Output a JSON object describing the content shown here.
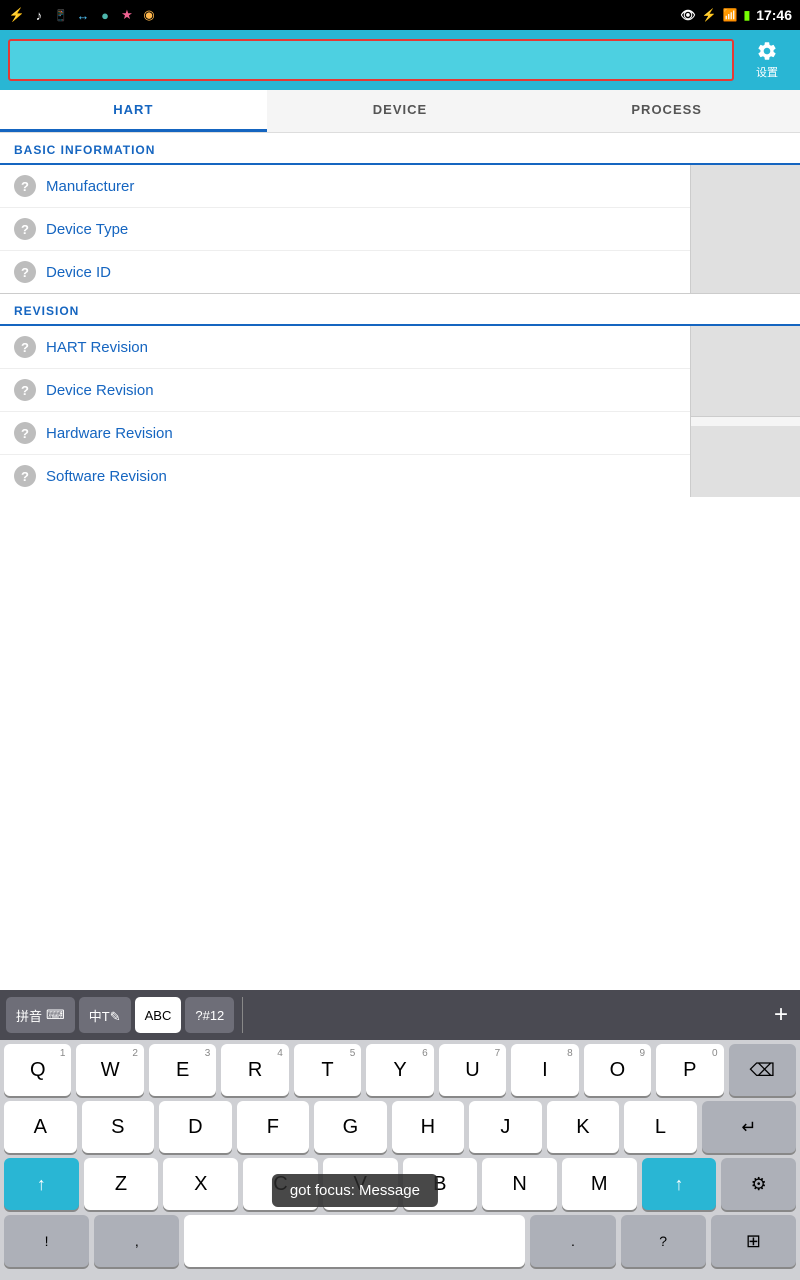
{
  "statusBar": {
    "time": "17:46",
    "icons": [
      "usb",
      "music",
      "phone",
      "arrows",
      "circle",
      "star",
      "face"
    ]
  },
  "header": {
    "inputValue": "",
    "inputPlaceholder": "",
    "settingsLabel": "设置"
  },
  "tabs": [
    {
      "id": "hart",
      "label": "HART",
      "active": true
    },
    {
      "id": "device",
      "label": "DEVICE",
      "active": false
    },
    {
      "id": "process",
      "label": "PROCESS",
      "active": false
    }
  ],
  "sections": {
    "basicInfo": {
      "title": "BASIC INFORMATION",
      "rows": [
        {
          "id": "manufacturer",
          "label": "Manufacturer"
        },
        {
          "id": "device-type",
          "label": "Device Type"
        },
        {
          "id": "device-id",
          "label": "Device ID"
        }
      ]
    },
    "revision": {
      "title": "REVISION",
      "rows": [
        {
          "id": "hart-revision",
          "label": "HART Revision"
        },
        {
          "id": "device-revision",
          "label": "Device Revision"
        },
        {
          "id": "hardware-revision",
          "label": "Hardware Revision"
        },
        {
          "id": "software-revision",
          "label": "Software Revision"
        }
      ]
    }
  },
  "keyboard": {
    "toolbar": {
      "pinyinLabel": "拼音",
      "keyboardIcon": "⌨",
      "chineseLabel": "中T✎",
      "abcLabel": "ABC",
      "specialLabel": "?#12",
      "plusLabel": "+"
    },
    "rows": [
      [
        {
          "key": "Q",
          "num": "1"
        },
        {
          "key": "W",
          "num": "2"
        },
        {
          "key": "E",
          "num": "3"
        },
        {
          "key": "R",
          "num": "4"
        },
        {
          "key": "T",
          "num": "5"
        },
        {
          "key": "Y",
          "num": "6"
        },
        {
          "key": "U",
          "num": "7"
        },
        {
          "key": "I",
          "num": "8"
        },
        {
          "key": "O",
          "num": "9"
        },
        {
          "key": "P",
          "num": "0"
        },
        {
          "key": "⌫",
          "num": "",
          "type": "backspace"
        }
      ],
      [
        {
          "key": "A",
          "num": ""
        },
        {
          "key": "S",
          "num": ""
        },
        {
          "key": "D",
          "num": ""
        },
        {
          "key": "F",
          "num": ""
        },
        {
          "key": "G",
          "num": ""
        },
        {
          "key": "H",
          "num": ""
        },
        {
          "key": "J",
          "num": ""
        },
        {
          "key": "K",
          "num": ""
        },
        {
          "key": "L",
          "num": ""
        },
        {
          "key": "↵",
          "num": "",
          "type": "return"
        }
      ],
      [
        {
          "key": "↑",
          "num": "",
          "type": "shift"
        },
        {
          "key": "Z",
          "num": ""
        },
        {
          "key": "X",
          "num": ""
        },
        {
          "key": "C",
          "num": ""
        },
        {
          "key": "V",
          "num": ""
        },
        {
          "key": "B",
          "num": ""
        },
        {
          "key": "N",
          "num": ""
        },
        {
          "key": "M",
          "num": ""
        },
        {
          "key": "↑",
          "num": "",
          "type": "shift2"
        },
        {
          "key": "⚙",
          "num": "",
          "type": "settings"
        }
      ],
      [
        {
          "key": "!",
          "num": "",
          "type": "special"
        },
        {
          "key": ",",
          "num": "",
          "type": "special"
        },
        {
          "key": " ",
          "num": "",
          "type": "space"
        },
        {
          "key": ".",
          "num": "",
          "type": "special"
        },
        {
          "key": "?",
          "num": "",
          "type": "special"
        },
        {
          "key": "⊞",
          "num": "",
          "type": "special"
        }
      ]
    ],
    "focusTooltip": "got focus: Message"
  }
}
